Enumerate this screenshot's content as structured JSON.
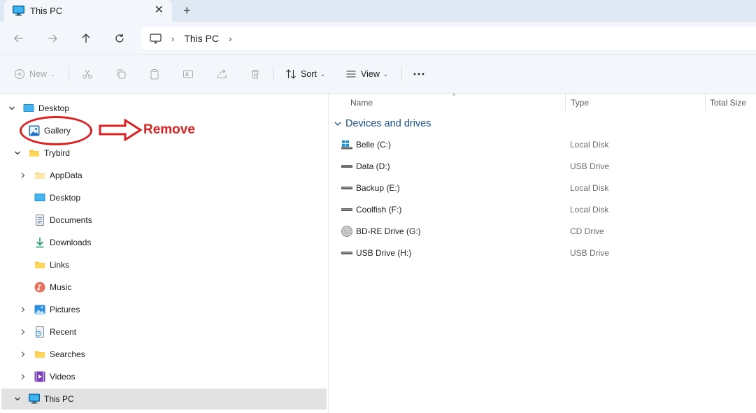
{
  "window": {
    "tab_title": "This PC",
    "close_glyph": "✕",
    "new_tab_glyph": "+"
  },
  "nav": {
    "back_icon": "arrow-left",
    "forward_icon": "arrow-right",
    "up_icon": "arrow-up",
    "refresh_icon": "refresh"
  },
  "address": {
    "crumbs": [
      "This PC"
    ],
    "separator": "›"
  },
  "commands": {
    "new_label": "New",
    "sort_label": "Sort",
    "view_label": "View",
    "more_glyph": "···"
  },
  "sidebar": {
    "items": [
      {
        "label": "Desktop",
        "icon": "desktop-icon",
        "expanded": true
      },
      {
        "label": "Gallery",
        "icon": "gallery-icon"
      },
      {
        "label": "Trybird",
        "icon": "folder-icon",
        "expanded": true
      },
      {
        "label": "AppData",
        "icon": "folder-icon"
      },
      {
        "label": "Desktop",
        "icon": "desktop-icon"
      },
      {
        "label": "Documents",
        "icon": "documents-icon"
      },
      {
        "label": "Downloads",
        "icon": "downloads-icon"
      },
      {
        "label": "Links",
        "icon": "folder-icon"
      },
      {
        "label": "Music",
        "icon": "music-icon"
      },
      {
        "label": "Pictures",
        "icon": "pictures-icon"
      },
      {
        "label": "Recent",
        "icon": "recent-icon"
      },
      {
        "label": "Searches",
        "icon": "folder-icon"
      },
      {
        "label": "Videos",
        "icon": "videos-icon"
      },
      {
        "label": "This PC",
        "icon": "pc-icon",
        "selected": true
      }
    ]
  },
  "annotation": {
    "text": "Remove",
    "color": "#e02020"
  },
  "columns": {
    "name": "Name",
    "type": "Type",
    "total_size": "Total Size"
  },
  "group": {
    "label": "Devices and drives"
  },
  "drives": [
    {
      "name": "Belle (C:)",
      "type": "Local Disk",
      "icon": "windows-drive-icon"
    },
    {
      "name": "Data (D:)",
      "type": "USB Drive",
      "icon": "drive-icon"
    },
    {
      "name": "Backup (E:)",
      "type": "Local Disk",
      "icon": "drive-icon"
    },
    {
      "name": "Coolfish (F:)",
      "type": "Local Disk",
      "icon": "drive-icon"
    },
    {
      "name": "BD-RE Drive (G:)",
      "type": "CD Drive",
      "icon": "disc-icon"
    },
    {
      "name": "USB Drive (H:)",
      "type": "USB Drive",
      "icon": "drive-icon"
    }
  ],
  "colors": {
    "accent": "#1a4ea1",
    "tabbar": "#dfe9f4",
    "toolbar": "#f3f6fa",
    "selected": "#e2e2e2"
  }
}
